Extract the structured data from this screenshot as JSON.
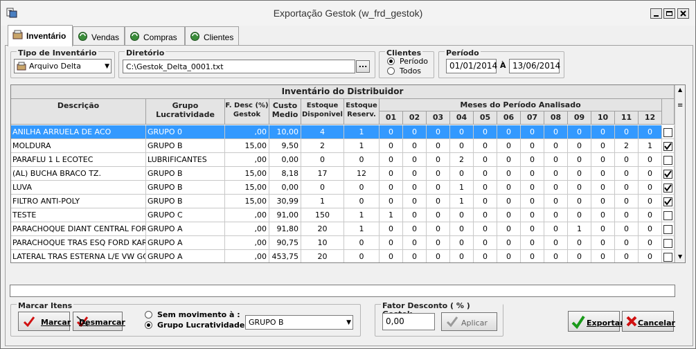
{
  "window": {
    "title": "Exportação Gestok (w_frd_gestok)"
  },
  "tabs": [
    {
      "label": "Inventário",
      "active": true
    },
    {
      "label": "Vendas"
    },
    {
      "label": "Compras"
    },
    {
      "label": "Clientes"
    }
  ],
  "tipo": {
    "legend": "Tipo de Inventário",
    "value": "Arquivo Delta"
  },
  "diretorio": {
    "legend": "Diretório",
    "value": "C:\\Gestok_Delta_0001.txt",
    "browse_label": "..."
  },
  "clientes": {
    "legend": "Clientes",
    "options": [
      {
        "label": "Período",
        "selected": true
      },
      {
        "label": "Todos",
        "selected": false
      }
    ]
  },
  "periodo": {
    "legend": "Período",
    "from": "01/01/2014",
    "sep": "À",
    "to": "13/06/2014"
  },
  "grid": {
    "title": "Inventário do Distribuidor",
    "headers": {
      "descricao": "Descrição",
      "grupo": "Grupo\nLucratividade",
      "fdesc": "F. Desc (%)\nGestok",
      "custo": "Custo\nMedio",
      "estoque_disp": "Estoque\nDisponivel",
      "estoque_res": "Estoque\nReserv.",
      "meses": "Meses do Período Analisado",
      "months": [
        "01",
        "02",
        "03",
        "04",
        "05",
        "06",
        "07",
        "08",
        "09",
        "10",
        "11",
        "12"
      ]
    },
    "rows": [
      {
        "desc": "ANILHA ARRUELA DE ACO",
        "grupo": "GRUPO 0",
        "fdesc": ",00",
        "custo": "10,00",
        "disp": "4",
        "res": "1",
        "m": [
          "0",
          "0",
          "0",
          "0",
          "0",
          "0",
          "0",
          "0",
          "0",
          "0",
          "0",
          "0"
        ],
        "checked": false,
        "selected": true
      },
      {
        "desc": "MOLDURA",
        "grupo": "GRUPO B",
        "fdesc": "15,00",
        "custo": "9,50",
        "disp": "2",
        "res": "1",
        "m": [
          "0",
          "0",
          "0",
          "0",
          "0",
          "0",
          "0",
          "0",
          "0",
          "0",
          "2",
          "1"
        ],
        "checked": true
      },
      {
        "desc": "PARAFLU 1 L   ECOTEC",
        "grupo": "LUBRIFICANTES",
        "fdesc": ",00",
        "custo": "0,00",
        "disp": "0",
        "res": "0",
        "m": [
          "0",
          "0",
          "0",
          "2",
          "0",
          "0",
          "0",
          "0",
          "0",
          "0",
          "0",
          "0"
        ],
        "checked": false
      },
      {
        "desc": "(AL) BUCHA BRACO TZ.",
        "grupo": "GRUPO B",
        "fdesc": "15,00",
        "custo": "8,18",
        "disp": "17",
        "res": "12",
        "m": [
          "0",
          "0",
          "0",
          "0",
          "0",
          "0",
          "0",
          "0",
          "0",
          "0",
          "0",
          "0"
        ],
        "checked": true
      },
      {
        "desc": "LUVA",
        "grupo": "GRUPO B",
        "fdesc": "15,00",
        "custo": "0,00",
        "disp": "0",
        "res": "0",
        "m": [
          "0",
          "0",
          "0",
          "1",
          "0",
          "0",
          "0",
          "0",
          "0",
          "0",
          "0",
          "0"
        ],
        "checked": true
      },
      {
        "desc": "FILTRO ANTI-POLY",
        "grupo": "GRUPO B",
        "fdesc": "15,00",
        "custo": "30,99",
        "disp": "1",
        "res": "0",
        "m": [
          "0",
          "0",
          "0",
          "1",
          "0",
          "0",
          "0",
          "0",
          "0",
          "0",
          "0",
          "0"
        ],
        "checked": true
      },
      {
        "desc": "TESTE",
        "grupo": "GRUPO C",
        "fdesc": ",00",
        "custo": "91,00",
        "disp": "150",
        "res": "1",
        "m": [
          "1",
          "0",
          "0",
          "0",
          "0",
          "0",
          "0",
          "0",
          "0",
          "0",
          "0",
          "0"
        ],
        "checked": false
      },
      {
        "desc": "PARACHOQUE DIANT CENTRAL FORD KA",
        "grupo": "GRUPO A",
        "fdesc": ",00",
        "custo": "91,80",
        "disp": "20",
        "res": "1",
        "m": [
          "0",
          "0",
          "0",
          "0",
          "0",
          "0",
          "0",
          "0",
          "1",
          "0",
          "0",
          "0"
        ],
        "checked": false
      },
      {
        "desc": "PARACHOQUE TRAS ESQ FORD KAR",
        "grupo": "GRUPO A",
        "fdesc": ",00",
        "custo": "90,75",
        "disp": "10",
        "res": "0",
        "m": [
          "0",
          "0",
          "0",
          "0",
          "0",
          "0",
          "0",
          "0",
          "0",
          "0",
          "0",
          "0"
        ],
        "checked": false
      },
      {
        "desc": "LATERAL TRAS ESTERNA L/E VW GOL",
        "grupo": "GRUPO A",
        "fdesc": ",00",
        "custo": "453,75",
        "disp": "20",
        "res": "0",
        "m": [
          "0",
          "0",
          "0",
          "0",
          "0",
          "0",
          "0",
          "0",
          "0",
          "0",
          "0",
          "0"
        ],
        "checked": false
      }
    ]
  },
  "marcar": {
    "legend": "Marcar Itens",
    "marcar_label": "Marcar",
    "desmarcar_label": "Desmarcar",
    "opt_sem": "Sem movimento à :",
    "opt_grupo": "Grupo Lucratividade:",
    "grupo_value": "GRUPO B"
  },
  "fator": {
    "legend": "Fator Desconto ( % ) Gestok",
    "value": "0,00",
    "apply_label": "Aplicar"
  },
  "actions": {
    "exportar": "Exportar",
    "cancelar": "Cancelar"
  },
  "colors": {
    "selection": "#3399ff",
    "check_green": "#1a9a1a",
    "cancel_red": "#d01010"
  }
}
